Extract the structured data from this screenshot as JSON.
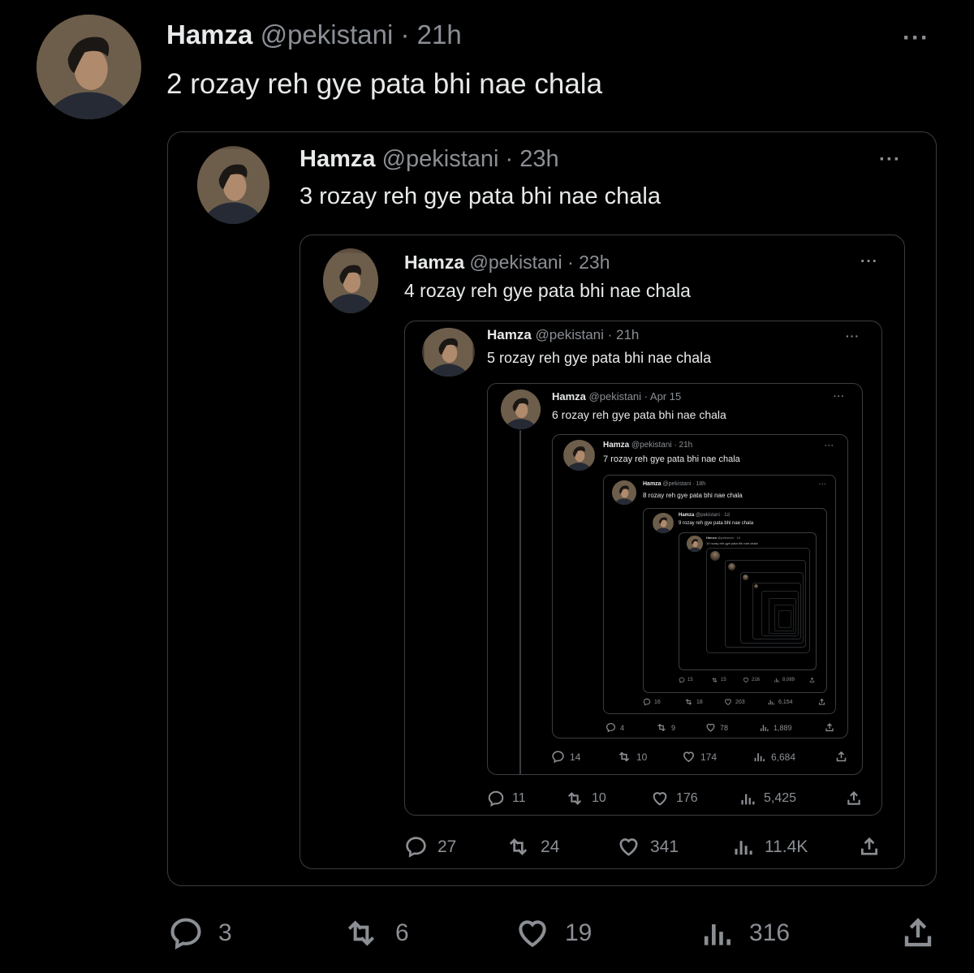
{
  "tweet": {
    "name": "Hamza",
    "handle": "@pekistani",
    "time": "· 21h",
    "text": "2 rozay reh gye pata bhi nae chala",
    "more_icon": "more-horizontal-icon",
    "stats": {
      "replies": "3",
      "retweets": "6",
      "likes": "19",
      "views": "316"
    }
  },
  "quote1": {
    "name": "Hamza",
    "handle": "@pekistani",
    "time": "· 23h",
    "text": "3 rozay reh gye pata bhi nae chala"
  },
  "quote2": {
    "name": "Hamza",
    "handle": "@pekistani",
    "time": "· 23h",
    "text": "4 rozay reh gye pata bhi nae chala",
    "stats": {
      "replies": "27",
      "retweets": "24",
      "likes": "341",
      "views": "11.4K"
    }
  },
  "quote3": {
    "name": "Hamza",
    "handle": "@pekistani",
    "time": "· 21h",
    "text": "5 rozay reh gye pata bhi nae chala",
    "stats": {
      "replies": "11",
      "retweets": "10",
      "likes": "176",
      "views": "5,425"
    }
  },
  "quote4": {
    "name": "Hamza",
    "handle": "@pekistani",
    "time": "· Apr 15",
    "text": "6 rozay reh gye pata bhi nae chala",
    "stats": {
      "replies": "14",
      "retweets": "10",
      "likes": "174",
      "views": "6,684"
    }
  },
  "quote5": {
    "name": "Hamza",
    "handle": "@pekistani",
    "time": "· 21h",
    "text": "7 rozay reh gye pata bhi nae chala",
    "stats": {
      "replies": "4",
      "retweets": "9",
      "likes": "78",
      "views": "1,889"
    }
  },
  "quote6": {
    "name": "Hamza",
    "handle": "@pekistani",
    "time": "· 18h",
    "text": "8 rozay reh gye pata bhi nae chala",
    "stats": {
      "replies": "16",
      "retweets": "18",
      "likes": "203",
      "views": "6,154"
    }
  },
  "quote7": {
    "name": "Hamza",
    "handle": "@pekistani",
    "time": "· 1d",
    "text": "9 rozay reh gye pata bhi nae chala",
    "stats": {
      "replies": "15",
      "retweets": "15",
      "likes": "216",
      "views": "8,089"
    }
  },
  "quote8": {
    "name": "Hamza",
    "handle": "@pekistani",
    "time": "· 1d",
    "text": "10 rozay reh gye pata bhi nae chala"
  },
  "colors": {
    "background": "#000000",
    "text": "#e7e9ea",
    "muted": "#8b8f94",
    "border": "#3a3d41"
  }
}
